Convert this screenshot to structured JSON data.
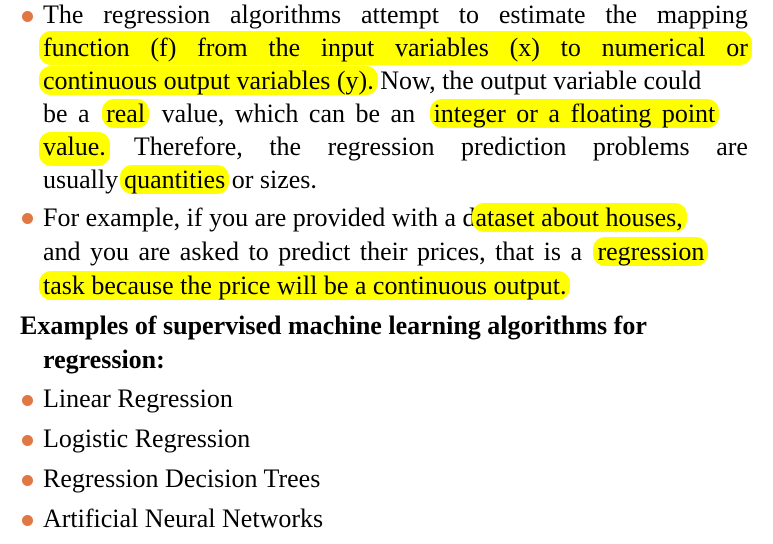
{
  "colors": {
    "bullet": "#e07845",
    "highlight": "#ffff00",
    "text": "#000000"
  },
  "paragraph1": {
    "l1": [
      "The",
      "regression",
      "algorithms",
      "attempt",
      "to",
      "estimate",
      "the",
      "mapping"
    ],
    "l2": [
      "function",
      "(f)",
      "from",
      "the",
      "input",
      "variables",
      "(x)",
      "to",
      "numerical",
      "or"
    ],
    "l3_hl": "continuous output variables (y).",
    "l3_rest": "Now, the output variable could",
    "l4_a": "be a",
    "l4_hl1": "real",
    "l4_b": "value, which can be an",
    "l4_hl2": "integer or a floating point",
    "l5_hl": "value.",
    "l5_rest": [
      "Therefore,",
      "the",
      "regression",
      "prediction",
      "problems",
      "are"
    ],
    "l6_a": "usually",
    "l6_hl": "quantities",
    "l6_b": "or sizes."
  },
  "paragraph2": {
    "l1_a": "For example, if you are provided with a d",
    "l1_hl": "ataset about houses,",
    "l2_a": "and you are asked to predict their prices, that is a",
    "l2_hl": "regression",
    "l3_hl": "task because the price will be a continuous output."
  },
  "section_heading": {
    "line1": "Examples of supervised machine learning algorithms for",
    "line2": "regression:"
  },
  "algorithms": [
    "Linear Regression",
    "Logistic Regression",
    "Regression Decision Trees",
    "Artificial Neural Networks"
  ]
}
